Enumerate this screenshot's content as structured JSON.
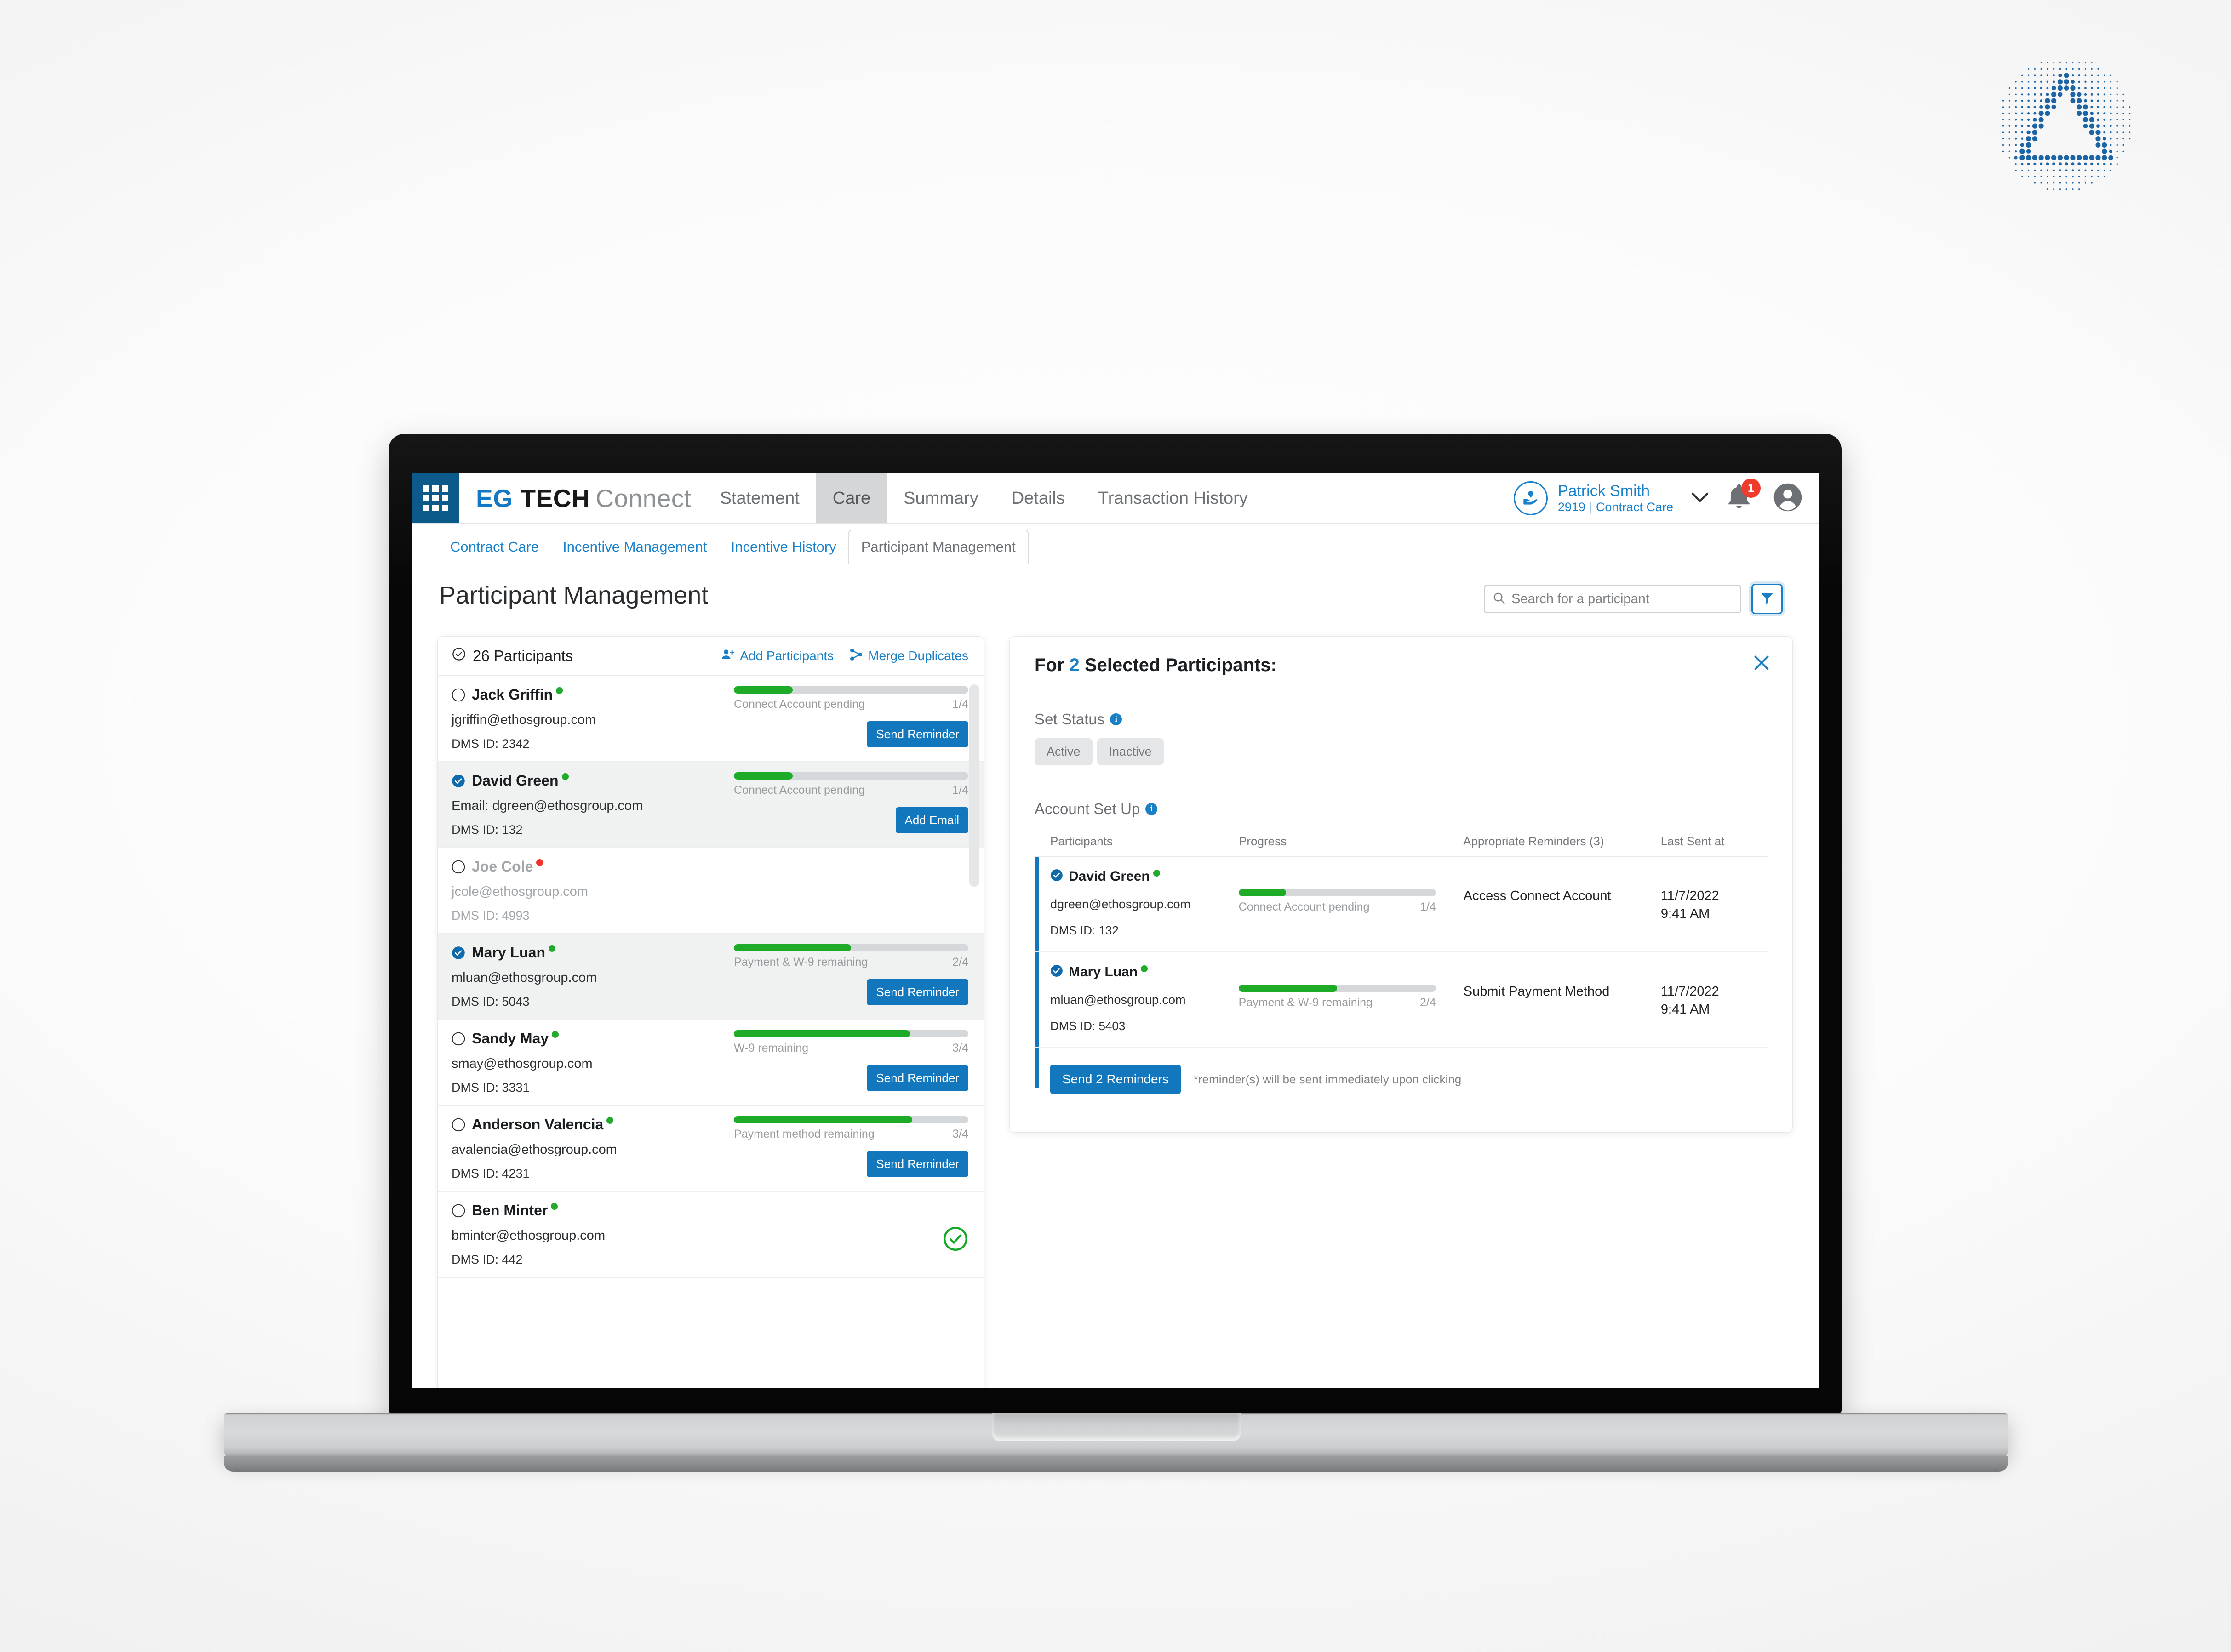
{
  "brand": {
    "eg": "EG",
    "tech": "TECH",
    "connect": "Connect"
  },
  "topnav": {
    "items": [
      {
        "label": "Statement",
        "active": false
      },
      {
        "label": "Care",
        "active": true
      },
      {
        "label": "Summary",
        "active": false
      },
      {
        "label": "Details",
        "active": false
      },
      {
        "label": "Transaction History",
        "active": false
      }
    ],
    "user": {
      "name": "Patrick Smith",
      "id": "2919",
      "divider": "|",
      "role": "Contract Care"
    },
    "notification_count": "1"
  },
  "subtabs": [
    {
      "label": "Contract Care",
      "active": false
    },
    {
      "label": "Incentive Management",
      "active": false
    },
    {
      "label": "Incentive History",
      "active": false
    },
    {
      "label": "Participant Management",
      "active": true
    }
  ],
  "page": {
    "title": "Participant Management"
  },
  "search": {
    "placeholder": "Search for a participant",
    "value": ""
  },
  "participants_panel": {
    "count_label": "26 Participants",
    "add_label": "Add Participants",
    "merge_label": "Merge Duplicates",
    "rows": [
      {
        "name": "Jack Griffin",
        "status_dot": "green",
        "selected": false,
        "muted": false,
        "email": "jgriffin@ethosgroup.com",
        "dms": "DMS ID: 2342",
        "progress_label": "Connect Account pending",
        "progress_fraction": "1/4",
        "progress_pct": 25,
        "action": "Send Reminder",
        "complete": false
      },
      {
        "name": "David Green",
        "status_dot": "green",
        "selected": true,
        "muted": false,
        "email": "Email: dgreen@ethosgroup.com",
        "dms": "DMS ID: 132",
        "progress_label": "Connect Account pending",
        "progress_fraction": "1/4",
        "progress_pct": 25,
        "action": "Add Email",
        "complete": false
      },
      {
        "name": "Joe Cole",
        "status_dot": "red",
        "selected": false,
        "muted": true,
        "email": "jcole@ethosgroup.com",
        "dms": "DMS ID: 4993",
        "progress_label": "",
        "progress_fraction": "",
        "progress_pct": null,
        "action": "",
        "complete": false
      },
      {
        "name": "Mary Luan",
        "status_dot": "green",
        "selected": true,
        "muted": false,
        "email": "mluan@ethosgroup.com",
        "dms": "DMS ID: 5043",
        "progress_label": "Payment & W-9 remaining",
        "progress_fraction": "2/4",
        "progress_pct": 50,
        "action": "Send Reminder",
        "complete": false
      },
      {
        "name": "Sandy May",
        "status_dot": "green",
        "selected": false,
        "muted": false,
        "email": "smay@ethosgroup.com",
        "dms": "DMS ID: 3331",
        "progress_label": "W-9 remaining",
        "progress_fraction": "3/4",
        "progress_pct": 75,
        "action": "Send Reminder",
        "complete": false
      },
      {
        "name": "Anderson Valencia",
        "status_dot": "green",
        "selected": false,
        "muted": false,
        "email": "avalencia@ethosgroup.com",
        "dms": "DMS ID: 4231",
        "progress_label": "Payment method remaining",
        "progress_fraction": "3/4",
        "progress_pct": 76,
        "action": "Send Reminder",
        "complete": false
      },
      {
        "name": "Ben Minter",
        "status_dot": "green",
        "selected": false,
        "muted": false,
        "email": "bminter@ethosgroup.com",
        "dms": "DMS ID: 442",
        "progress_label": "",
        "progress_fraction": "",
        "progress_pct": null,
        "action": "",
        "complete": true
      }
    ]
  },
  "detail_panel": {
    "title_prefix": "For",
    "selected_count": "2",
    "title_suffix": "Selected Participants:",
    "set_status_label": "Set Status",
    "status_options": [
      "Active",
      "Inactive"
    ],
    "account_setup_label": "Account Set Up",
    "columns": [
      "Participants",
      "Progress",
      "Appropriate Reminders (3)",
      "Last Sent at"
    ],
    "rows": [
      {
        "name": "David Green",
        "status_dot": "green",
        "email": "dgreen@ethosgroup.com",
        "dms": "DMS ID: 132",
        "progress_label": "Connect Account pending",
        "progress_fraction": "1/4",
        "progress_pct": 24,
        "reminder": "Access Connect Account",
        "last_sent_date": "11/7/2022",
        "last_sent_time": "9:41 AM"
      },
      {
        "name": "Mary Luan",
        "status_dot": "green",
        "email": "mluan@ethosgroup.com",
        "dms": "DMS ID: 5403",
        "progress_label": "Payment & W-9 remaining",
        "progress_fraction": "2/4",
        "progress_pct": 50,
        "reminder": "Submit Payment Method",
        "last_sent_date": "11/7/2022",
        "last_sent_time": "9:41 AM"
      }
    ],
    "send_button": "Send 2 Reminders",
    "send_note": "*reminder(s) will be sent immediately upon clicking"
  },
  "colors": {
    "brand_blue": "#1479c4",
    "nav_blue": "#0b5a8a",
    "button_blue": "#1277bd",
    "green": "#1eab28",
    "red": "#ef3b2d"
  }
}
